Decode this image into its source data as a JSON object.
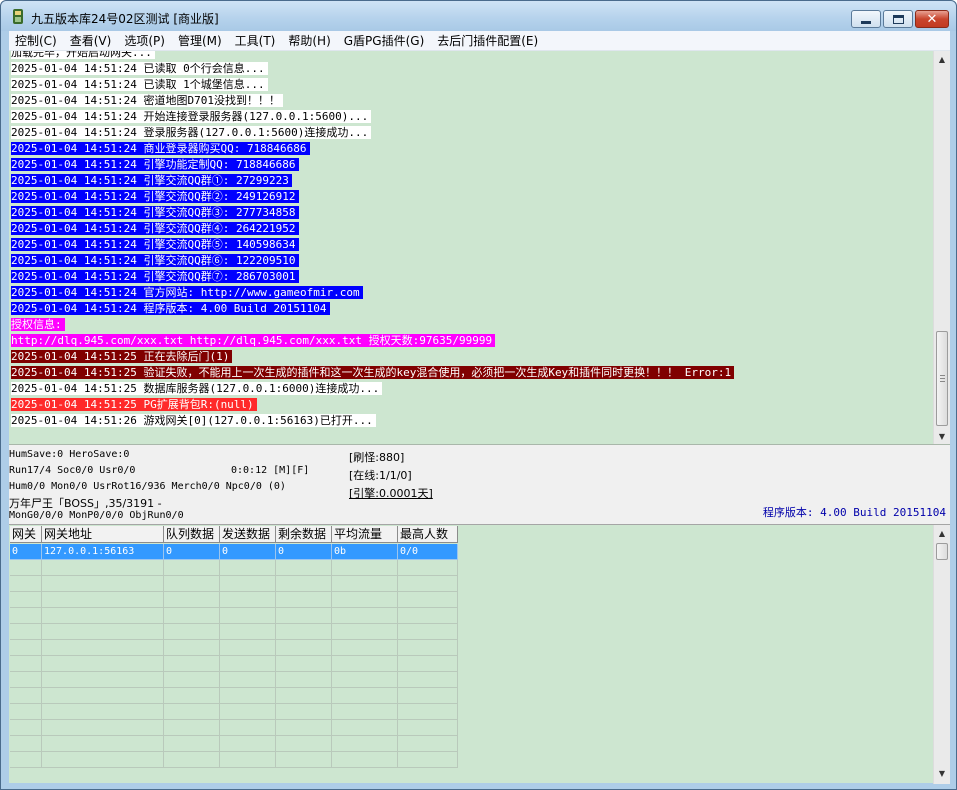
{
  "window": {
    "title": "九五版本库24号02区测试 [商业版]"
  },
  "menu": [
    {
      "label": "控制(C)"
    },
    {
      "label": "查看(V)"
    },
    {
      "label": "选项(P)"
    },
    {
      "label": "管理(M)"
    },
    {
      "label": "工具(T)"
    },
    {
      "label": "帮助(H)"
    },
    {
      "label": "G盾PG插件(G)"
    },
    {
      "label": "去后门插件配置(E)"
    }
  ],
  "log": {
    "lines": [
      {
        "text": "加载完毕，开始启动网关...",
        "bg": "#ffffff",
        "fg": "#000000"
      },
      {
        "text": "2025-01-04 14:51:24 已读取 0个行会信息...",
        "bg": "#ffffff",
        "fg": "#000000"
      },
      {
        "text": "2025-01-04 14:51:24 已读取 1个城堡信息...",
        "bg": "#ffffff",
        "fg": "#000000"
      },
      {
        "text": "2025-01-04 14:51:24 密道地图D701没找到！！！",
        "bg": "#ffffff",
        "fg": "#000000"
      },
      {
        "text": "2025-01-04 14:51:24 开始连接登录服务器(127.0.0.1:5600)...",
        "bg": "#ffffff",
        "fg": "#000000"
      },
      {
        "text": "2025-01-04 14:51:24 登录服务器(127.0.0.1:5600)连接成功...",
        "bg": "#ffffff",
        "fg": "#000000"
      },
      {
        "text": "2025-01-04 14:51:24 商业登录器购买QQ: 718846686",
        "bg": "#0000ff",
        "fg": "#ffffff"
      },
      {
        "text": "2025-01-04 14:51:24 引擎功能定制QQ: 718846686",
        "bg": "#0000ff",
        "fg": "#ffffff"
      },
      {
        "text": "2025-01-04 14:51:24 引擎交流QQ群①: 27299223",
        "bg": "#0000ff",
        "fg": "#ffffff"
      },
      {
        "text": "2025-01-04 14:51:24 引擎交流QQ群②: 249126912",
        "bg": "#0000ff",
        "fg": "#ffffff"
      },
      {
        "text": "2025-01-04 14:51:24 引擎交流QQ群③: 277734858",
        "bg": "#0000ff",
        "fg": "#ffffff"
      },
      {
        "text": "2025-01-04 14:51:24 引擎交流QQ群④: 264221952",
        "bg": "#0000ff",
        "fg": "#ffffff"
      },
      {
        "text": "2025-01-04 14:51:24 引擎交流QQ群⑤: 140598634",
        "bg": "#0000ff",
        "fg": "#ffffff"
      },
      {
        "text": "2025-01-04 14:51:24 引擎交流QQ群⑥: 122209510",
        "bg": "#0000ff",
        "fg": "#ffffff"
      },
      {
        "text": "2025-01-04 14:51:24 引擎交流QQ群⑦: 286703001",
        "bg": "#0000ff",
        "fg": "#ffffff"
      },
      {
        "text": "2025-01-04 14:51:24 官方网站: http://www.gameofmir.com",
        "bg": "#0000ff",
        "fg": "#ffffff"
      },
      {
        "text": "2025-01-04 14:51:24 程序版本: 4.00 Build 20151104",
        "bg": "#0000ff",
        "fg": "#ffffff"
      },
      {
        "text": "授权信息:",
        "bg": "#ff00ff",
        "fg": "#ffffff"
      },
      {
        "text": "http://dlq.945.com/xxx.txt http://dlq.945.com/xxx.txt 授权天数:97635/99999",
        "bg": "#ff00ff",
        "fg": "#ffffff"
      },
      {
        "text": "2025-01-04 14:51:25 正在去除后门(1)",
        "bg": "#800000",
        "fg": "#ffffff"
      },
      {
        "text": "2025-01-04 14:51:25 验证失败，不能用上一次生成的插件和这一次生成的key混合使用，必须把一次生成Key和插件同时更换！！！ Error:1",
        "bg": "#800000",
        "fg": "#ffffff"
      },
      {
        "text": "2025-01-04 14:51:25 数据库服务器(127.0.0.1:6000)连接成功...",
        "bg": "#ffffff",
        "fg": "#000000"
      },
      {
        "text": "2025-01-04 14:51:25 PG扩展背包R:(null)",
        "bg": "#ff2a2a",
        "fg": "#ffffff"
      },
      {
        "text": "2025-01-04 14:51:26 游戏网关[0](127.0.0.1:56163)已打开...",
        "bg": "#ffffff",
        "fg": "#000000"
      }
    ]
  },
  "status": {
    "line1": "HumSave:0 HeroSave:0",
    "line2": "Run17/4 Soc0/0 Usr0/0",
    "timer": "0:0:12 [M][F]",
    "line3": "Hum0/0 Mon0/0 UsrRot16/936 Merch0/0 Npc0/0 (0)",
    "line4": "万年尸王「BOSS」,35/3191 -",
    "line5": "MonG0/0/0 MonP0/0/0 ObjRun0/0",
    "refresh": "[刷怪:880]",
    "online": "[在线:1/1/0]",
    "engine": "[引擎:0.0001天]",
    "version": "程序版本: 4.00 Build 20151104"
  },
  "grid": {
    "columns": [
      "网关",
      "网关地址",
      "队列数据",
      "发送数据",
      "剩余数据",
      "平均流量",
      "最高人数"
    ],
    "rows": [
      [
        "0",
        "127.0.0.1:56163",
        "0",
        "0",
        "0",
        "0b",
        "0/0"
      ]
    ]
  }
}
